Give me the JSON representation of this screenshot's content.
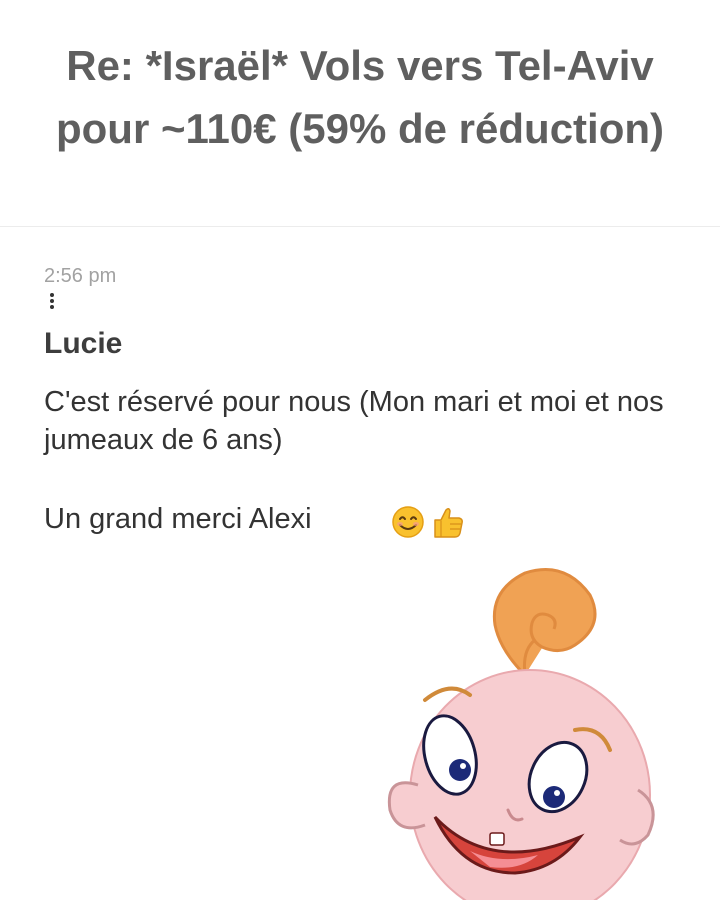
{
  "header": {
    "title": "Re: *Israël* Vols vers Tel-Aviv pour ~110€ (59% de réduction)"
  },
  "message": {
    "timestamp": "2:56 pm",
    "author": "Lucie",
    "body": "C'est réservé pour nous (Mon mari et moi et nos jumeaux de 6 ans)",
    "thanks": "Un grand merci Alexi",
    "emojis": [
      "smiling-face-icon",
      "thumbs-up-icon"
    ],
    "sticker": "baby-face-sticker"
  },
  "colors": {
    "title": "#5f5f5f",
    "timestamp": "#a2a2a2",
    "text": "#333333",
    "sticker_skin": "#f7cdd0",
    "sticker_hair": "#f0a254"
  }
}
